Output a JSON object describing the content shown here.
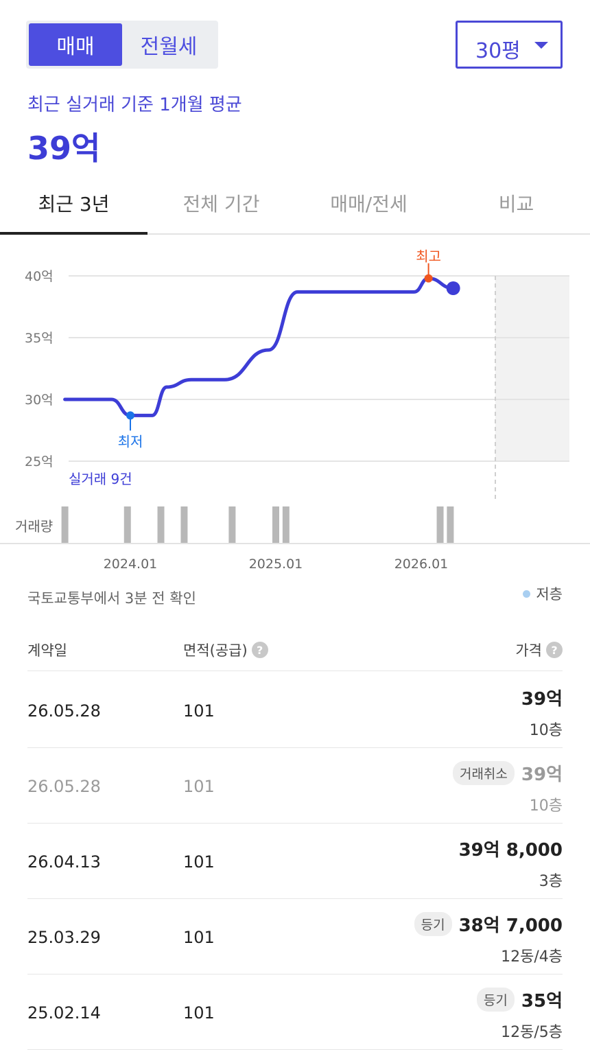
{
  "segment": {
    "options": [
      "매매",
      "전월세"
    ],
    "selected": "매매"
  },
  "size_select": {
    "value": "30평"
  },
  "summary": {
    "label": "최근 실거래 기준 1개월 평균",
    "value": "39억"
  },
  "tabs": [
    {
      "label": "최근 3년",
      "active": true
    },
    {
      "label": "전체 기간",
      "active": false
    },
    {
      "label": "매매/전세",
      "active": false
    },
    {
      "label": "비교",
      "active": false
    }
  ],
  "chart_data": {
    "type": "line",
    "y_unit": "억",
    "ylim": [
      25,
      40
    ],
    "y_ticks": [
      "40억",
      "35억",
      "30억",
      "25억"
    ],
    "y_tick_values": [
      40,
      35,
      30,
      25
    ],
    "x_ticks": [
      "2024.01",
      "2025.01",
      "2026.01"
    ],
    "x_tick_values": [
      2024.0,
      2025.0,
      2026.0
    ],
    "grid": true,
    "series": [
      {
        "x": [
          2023.55,
          2023.87,
          2024.0,
          2024.15,
          2024.25,
          2024.42,
          2024.65,
          2024.95,
          2025.15,
          2025.6,
          2025.95,
          2026.05,
          2026.22
        ],
        "values": [
          30.0,
          30.0,
          28.7,
          28.7,
          31.0,
          31.6,
          31.6,
          34.0,
          38.7,
          38.7,
          38.7,
          39.8,
          39.0
        ]
      }
    ],
    "annotations": {
      "max_label": "최고",
      "max_point": [
        2026.05,
        39.8
      ],
      "min_label": "최저",
      "min_point": [
        2024.0,
        28.7
      ],
      "count_label": "실거래 9건",
      "current_point": [
        2026.22,
        39.0
      ]
    },
    "volume_label": "거래량",
    "volume_x": [
      2023.55,
      2023.98,
      2024.21,
      2024.37,
      2024.7,
      2025.0,
      2025.07,
      2026.13,
      2026.2
    ],
    "line_color": "#3d3dd6",
    "max_color": "#f0561f",
    "min_color": "#1a73e8",
    "volume_color": "#b8b8b8"
  },
  "meta": {
    "source": "국토교통부에서 3분 전 확인",
    "legend": "저층"
  },
  "table": {
    "headers": {
      "date": "계약일",
      "area": "면적(공급)",
      "price": "가격",
      "help": "?"
    },
    "rows": [
      {
        "date": "26.05.28",
        "area": "101",
        "price": "39억",
        "floor": "10층",
        "badge": "",
        "cancelled": false
      },
      {
        "date": "26.05.28",
        "area": "101",
        "price": "39억",
        "floor": "10층",
        "badge": "거래취소",
        "cancelled": true
      },
      {
        "date": "26.04.13",
        "area": "101",
        "price": "39억 8,000",
        "floor": "3층",
        "badge": "",
        "cancelled": false
      },
      {
        "date": "25.03.29",
        "area": "101",
        "price": "38억 7,000",
        "floor": "12동/4층",
        "badge": "등기",
        "cancelled": false
      },
      {
        "date": "25.02.14",
        "area": "101",
        "price": "35억",
        "floor": "12동/5층",
        "badge": "등기",
        "cancelled": false
      }
    ]
  }
}
